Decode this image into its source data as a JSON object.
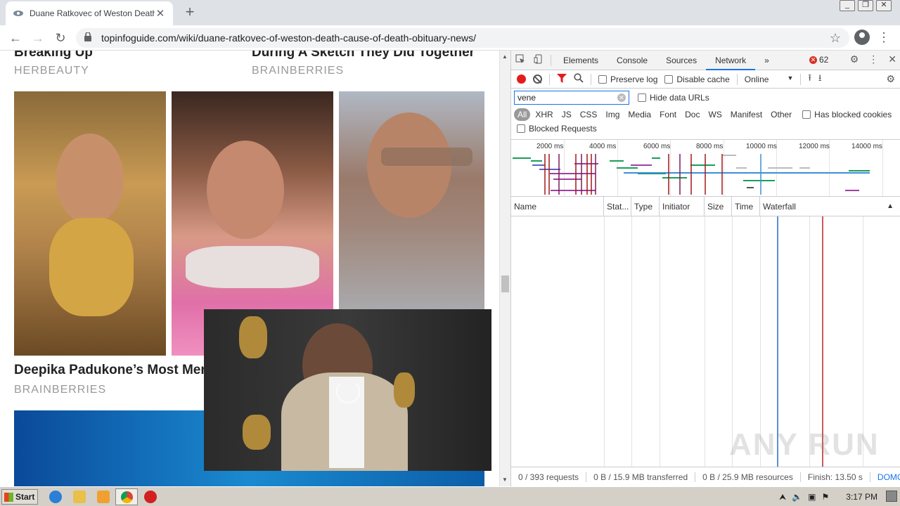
{
  "browser": {
    "tab_title": "Duane Ratkovec of Weston Death - ",
    "tab_close": "✕",
    "new_tab": "+",
    "url": "topinfoguide.com/wiki/duane-ratkovec-of-weston-death-cause-of-death-obituary-news/",
    "back": "←",
    "forward": "→",
    "reload": "↻",
    "star": "☆",
    "menu": "⋮"
  },
  "page": {
    "top_left_title": "Breaking Up",
    "top_left_source": "HERBEAUTY",
    "top_right_title": "During A Sketch They Did Together",
    "top_right_source": "BRAINBERRIES",
    "article_title": "Deepika Padukone’s Most Mer",
    "article_source": "BRAINBERRIES"
  },
  "devtools": {
    "tabs": [
      "Elements",
      "Console",
      "Sources",
      "Network"
    ],
    "more_tabs": "»",
    "error_count": "62",
    "preserve_log": "Preserve log",
    "disable_cache": "Disable cache",
    "throttle": "Online",
    "throttle_arrow": "▼",
    "filter_value": "vene",
    "hide_data_urls": "Hide data URLs",
    "types": [
      "All",
      "XHR",
      "JS",
      "CSS",
      "Img",
      "Media",
      "Font",
      "Doc",
      "WS",
      "Manifest",
      "Other"
    ],
    "has_blocked_cookies": "Has blocked cookies",
    "blocked_requests": "Blocked Requests",
    "timeline_ticks": [
      "2000 ms",
      "4000 ms",
      "6000 ms",
      "8000 ms",
      "10000 ms",
      "12000 ms",
      "14000 ms"
    ],
    "columns": [
      "Name",
      "Stat...",
      "Type",
      "Initiator",
      "Size",
      "Time",
      "Waterfall"
    ],
    "sort_indicator": "▲",
    "status": {
      "requests": "0 / 393 requests",
      "transferred": "0 B / 15.9 MB transferred",
      "resources": "0 B / 25.9 MB resources",
      "finish": "Finish: 13.50 s",
      "dom": "DOMCon"
    },
    "watermark": "ANY RUN"
  },
  "taskbar": {
    "start": "Start",
    "clock": "3:17 PM"
  },
  "colors": {
    "record": "#e41b1b",
    "accent": "#1a73e8",
    "waterfall_blue": "#5c8fd6",
    "waterfall_red": "#c85a5a"
  }
}
